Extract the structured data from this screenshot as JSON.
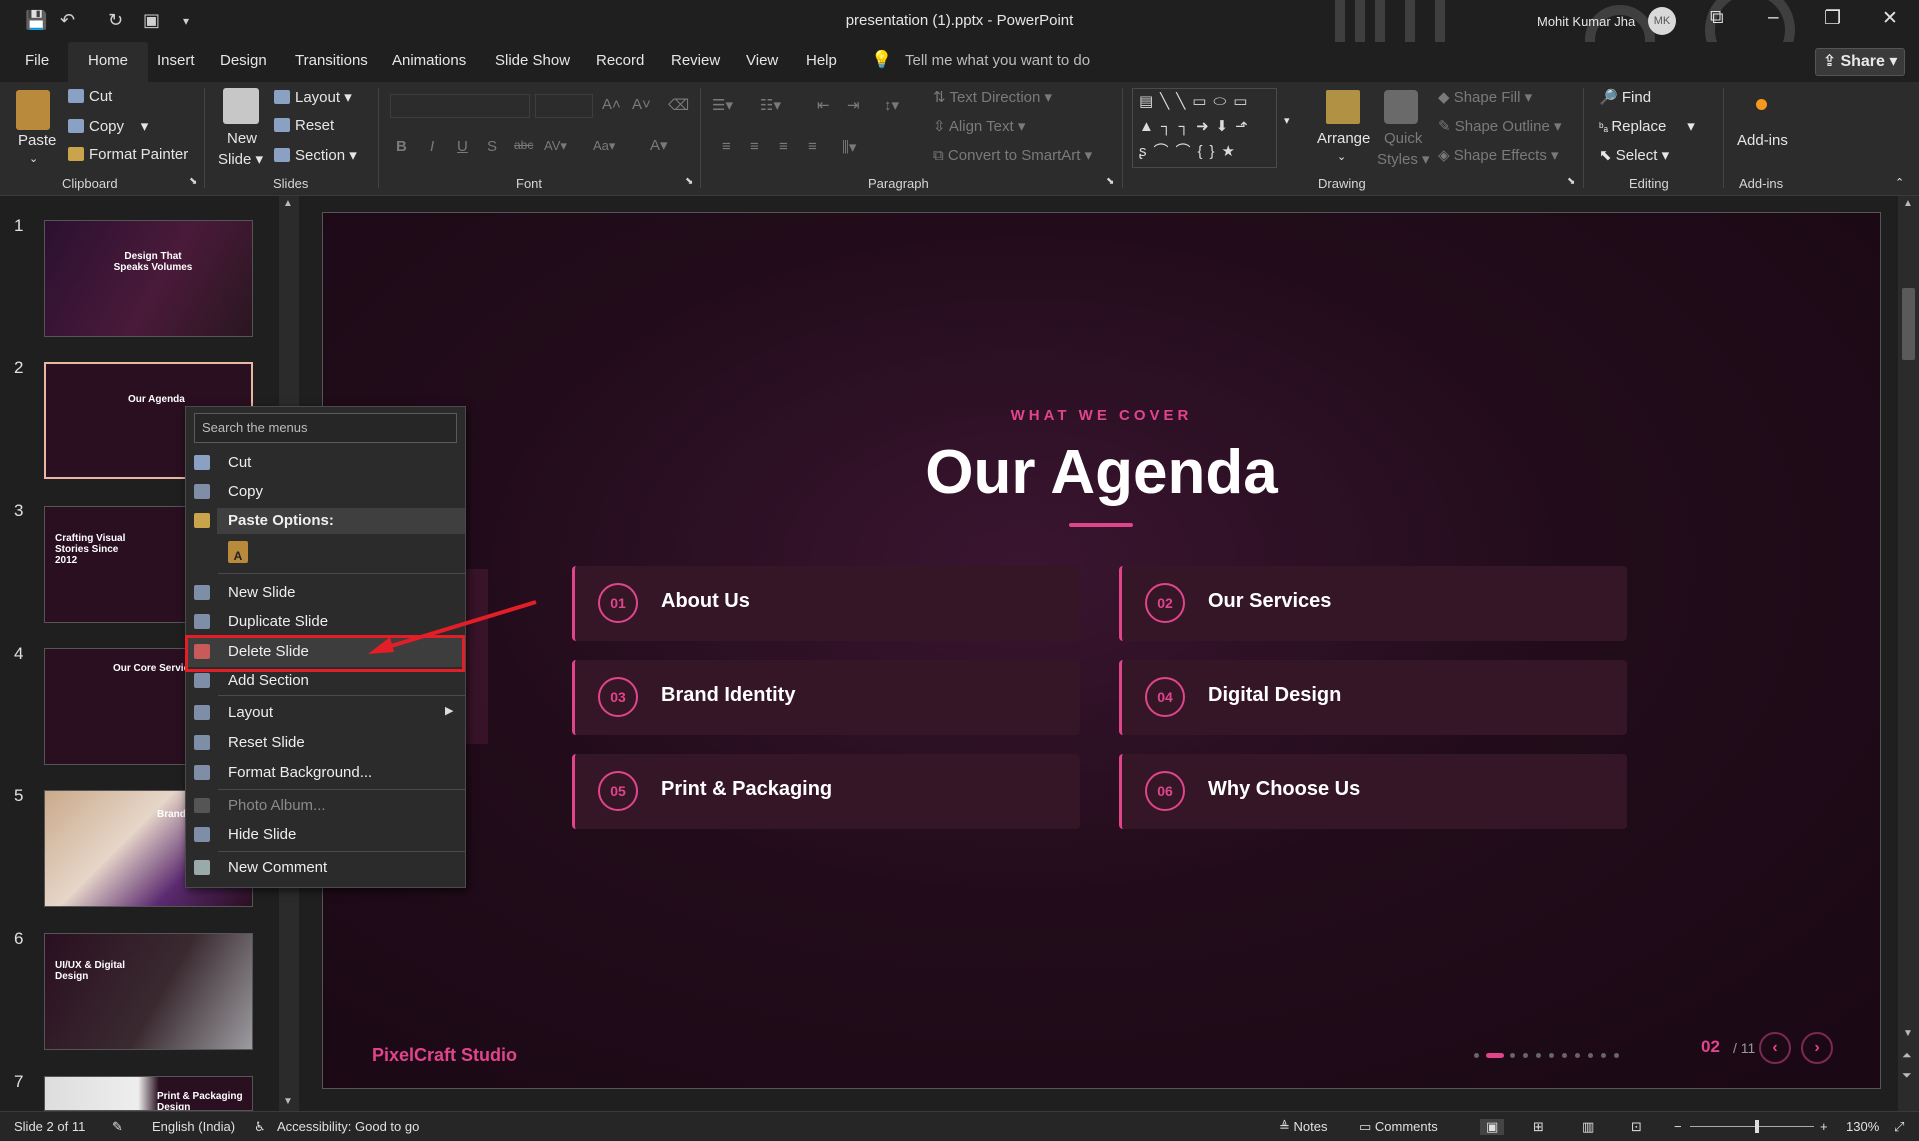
{
  "titlebar": {
    "doc_title": "presentation (1).pptx  -  PowerPoint",
    "user_name": "Mohit Kumar Jha",
    "user_initials": "MK"
  },
  "menubar": {
    "tabs": [
      "File",
      "Home",
      "Insert",
      "Design",
      "Transitions",
      "Animations",
      "Slide Show",
      "Record",
      "Review",
      "View",
      "Help"
    ],
    "tell_me": "Tell me what you want to do",
    "share": "Share"
  },
  "ribbon": {
    "clipboard": {
      "paste": "Paste",
      "cut": "Cut",
      "copy": "Copy",
      "format_painter": "Format Painter",
      "group": "Clipboard"
    },
    "slides": {
      "new_slide_line1": "New",
      "new_slide_line2": "Slide",
      "layout": "Layout",
      "reset": "Reset",
      "section": "Section",
      "group": "Slides"
    },
    "font": {
      "group": "Font"
    },
    "paragraph": {
      "text_direction": "Text Direction",
      "align_text": "Align Text",
      "convert_smartart": "Convert to SmartArt",
      "group": "Paragraph"
    },
    "drawing": {
      "arrange": "Arrange",
      "quick_styles_1": "Quick",
      "quick_styles_2": "Styles",
      "shape_fill": "Shape Fill",
      "shape_outline": "Shape Outline",
      "shape_effects": "Shape Effects",
      "group": "Drawing"
    },
    "editing": {
      "find": "Find",
      "replace": "Replace",
      "select": "Select",
      "group": "Editing"
    },
    "addins": {
      "label": "Add-ins",
      "group": "Add-ins"
    }
  },
  "thumbnails": [
    {
      "num": "1",
      "title": "Design That Speaks Volumes"
    },
    {
      "num": "2",
      "title": "Our Agenda"
    },
    {
      "num": "3",
      "title": "Crafting Visual Stories Since 2012"
    },
    {
      "num": "4",
      "title": "Our Core Services"
    },
    {
      "num": "5",
      "title": "Brand Id & Logo D"
    },
    {
      "num": "6",
      "title": "UI/UX & Digital Design"
    },
    {
      "num": "7",
      "title": "Print & Packaging Design"
    }
  ],
  "slide": {
    "eyebrow": "WHAT WE COVER",
    "title": "Our Agenda",
    "items": [
      {
        "num": "01",
        "label": "About Us"
      },
      {
        "num": "02",
        "label": "Our Services"
      },
      {
        "num": "03",
        "label": "Brand Identity"
      },
      {
        "num": "04",
        "label": "Digital Design"
      },
      {
        "num": "05",
        "label": "Print & Packaging"
      },
      {
        "num": "06",
        "label": "Why Choose Us"
      }
    ],
    "brand": "PixelCraft Studio",
    "page_current": "02",
    "page_total": "/ 11",
    "prev": "‹",
    "next": "›"
  },
  "context_menu": {
    "search_placeholder": "Search the menus",
    "cut": "Cut",
    "copy": "Copy",
    "paste_options": "Paste Options:",
    "new_slide": "New Slide",
    "duplicate_slide": "Duplicate Slide",
    "delete_slide": "Delete Slide",
    "add_section": "Add Section",
    "layout": "Layout",
    "reset_slide": "Reset Slide",
    "format_background": "Format Background...",
    "photo_album": "Photo Album...",
    "hide_slide": "Hide Slide",
    "new_comment": "New Comment"
  },
  "statusbar": {
    "slide_info": "Slide 2 of 11",
    "language": "English (India)",
    "accessibility": "Accessibility: Good to go",
    "notes": "Notes",
    "comments": "Comments",
    "zoom": "130%"
  },
  "colors": {
    "accent": "#e0458c",
    "annotation_red": "#e41e26",
    "slide_bg": "#200b18"
  }
}
